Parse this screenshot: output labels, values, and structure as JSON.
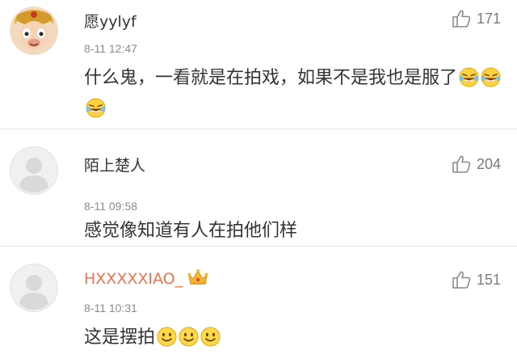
{
  "comments": [
    {
      "username": "愿yylyf",
      "timestamp": "8-11 12:47",
      "text": "什么鬼，一看就是在拍戏，如果不是我也是服了",
      "emojis": [
        "laugh-cry-emoji",
        "laugh-cry-emoji",
        "laugh-cry-emoji"
      ],
      "likes": "171",
      "avatar": "monkey-king-avatar"
    },
    {
      "username": "陌上楚人",
      "timestamp": "8-11 09:58",
      "text": "感觉像知道有人在拍他们样",
      "emojis": [],
      "likes": "204",
      "avatar": "default-avatar"
    },
    {
      "username": "HXXXXXIAO_",
      "username_color": "#eb7350",
      "badge": "crown-icon",
      "timestamp": "8-11 10:31",
      "text": "这是摆拍",
      "emojis": [
        "smile-emoji",
        "smile-emoji",
        "smile-emoji"
      ],
      "likes": "151",
      "avatar": "default-avatar"
    }
  ],
  "colors": {
    "text": "#333333",
    "meta": "#8a8a8a",
    "vip_name": "#eb7350",
    "divider": "#e6e6e6"
  }
}
